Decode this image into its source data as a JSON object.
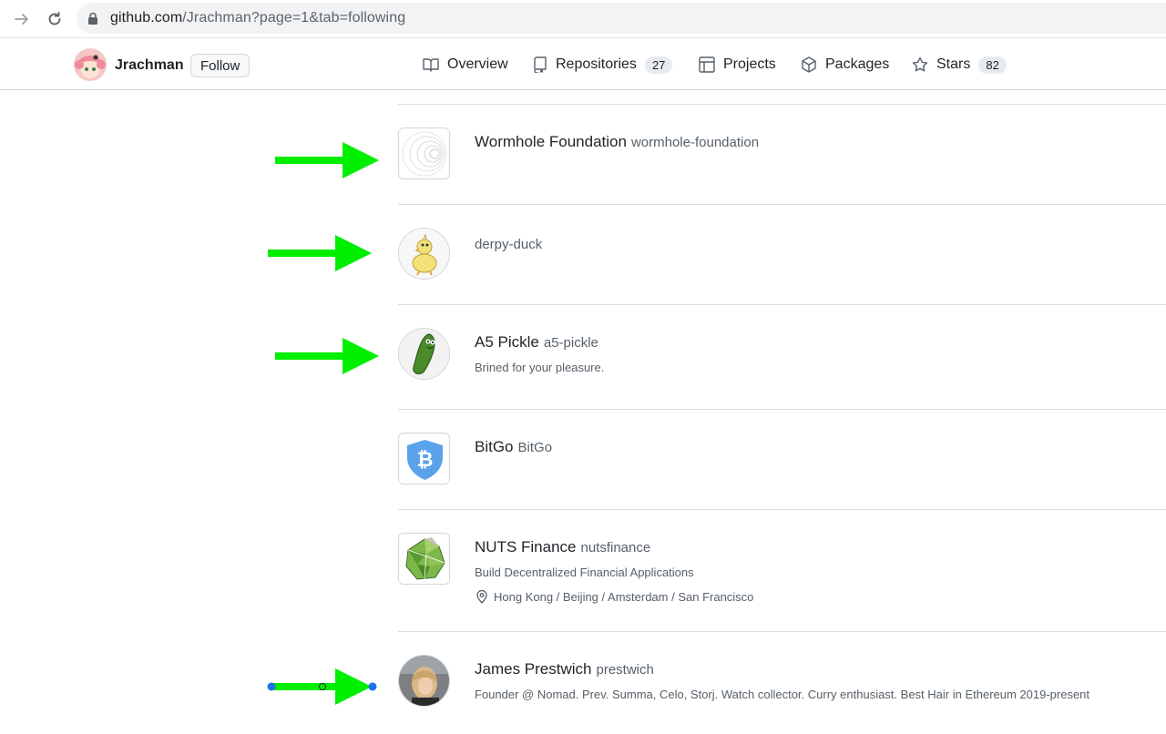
{
  "browser": {
    "url_host": "github.com",
    "url_path": "/Jrachman?page=1&tab=following"
  },
  "header": {
    "username": "Jrachman",
    "follow_label": "Follow",
    "tabs": [
      {
        "label": "Overview",
        "icon": "book-icon"
      },
      {
        "label": "Repositories",
        "count": "27",
        "icon": "repo-icon"
      },
      {
        "label": "Projects",
        "icon": "table-icon"
      },
      {
        "label": "Packages",
        "icon": "package-icon"
      },
      {
        "label": "Stars",
        "count": "82",
        "icon": "star-icon"
      }
    ]
  },
  "following": [
    {
      "name": "Wormhole Foundation",
      "login": "wormhole-foundation",
      "avatar": "wormhole-rings",
      "shape": "square"
    },
    {
      "name": "",
      "login": "derpy-duck",
      "avatar": "duck",
      "shape": "round"
    },
    {
      "name": "A5 Pickle",
      "login": "a5-pickle",
      "bio": "Brined for your pleasure.",
      "avatar": "pickle",
      "shape": "round"
    },
    {
      "name": "BitGo",
      "login": "BitGo",
      "avatar": "bitgo-shield",
      "shape": "square"
    },
    {
      "name": "NUTS Finance",
      "login": "nutsfinance",
      "bio": "Build Decentralized Financial Applications",
      "location": "Hong Kong / Beijing / Amsterdam / San Francisco",
      "avatar": "nuts-polyhedron",
      "shape": "square"
    },
    {
      "name": "James Prestwich",
      "login": "prestwich",
      "bio": "Founder @ Nomad. Prev. Summa, Celo, Storj. Watch collector. Curry enthusiast. Best Hair in Ethereum 2019-present",
      "avatar": "person-photo",
      "shape": "round"
    }
  ],
  "colors": {
    "arrow": "#00ee00",
    "handle": "#1a73e8"
  }
}
